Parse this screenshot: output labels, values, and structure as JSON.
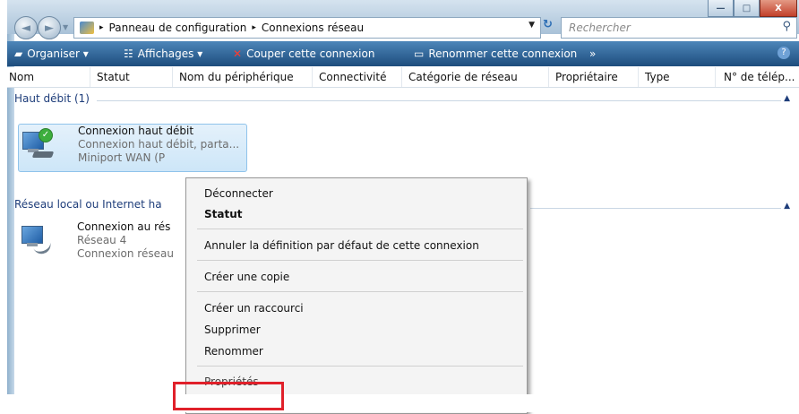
{
  "window": {
    "buttons": {
      "minimize": "—",
      "maximize": "□",
      "close": "X"
    }
  },
  "nav": {
    "back": "◄",
    "forward": "►",
    "breadcrumb": [
      "Panneau de configuration",
      "Connexions réseau"
    ],
    "separator": "▸",
    "search_placeholder": "Rechercher"
  },
  "toolbar": {
    "organize": "Organiser ▾",
    "views": "Affichages ▾",
    "disconnect": "Couper cette connexion",
    "rename": "Renommer cette connexion",
    "more": "»",
    "help": "?"
  },
  "columns": [
    "Nom",
    "Statut",
    "Nom du périphérique",
    "Connectivité",
    "Catégorie de réseau",
    "Propriétaire",
    "Type",
    "N° de télép..."
  ],
  "groups": [
    {
      "title": "Haut débit (1)",
      "item": {
        "name": "Connexion haut débit",
        "line2": "Connexion haut débit, parta...",
        "line3": "Miniport WAN (P"
      }
    },
    {
      "title": "Réseau local ou Internet ha",
      "item": {
        "name": "Connexion au rés",
        "line2": "Réseau 4",
        "line3": "Connexion réseau"
      }
    }
  ],
  "context_menu": {
    "items": [
      {
        "label": "Déconnecter",
        "bold": false
      },
      {
        "label": "Statut",
        "bold": true
      },
      {
        "label": "Annuler la définition par défaut de cette connexion",
        "bold": false
      },
      {
        "label": "Créer une copie",
        "bold": false
      },
      {
        "label": "Créer un raccourci",
        "bold": false
      },
      {
        "label": "Supprimer",
        "bold": false
      },
      {
        "label": "Renommer",
        "bold": false
      },
      {
        "label": "Propriétés",
        "bold": false
      }
    ]
  },
  "colors": {
    "toolbar": "#2a5d8f",
    "highlight": "#e0202a",
    "selection": "#cde6f8"
  }
}
